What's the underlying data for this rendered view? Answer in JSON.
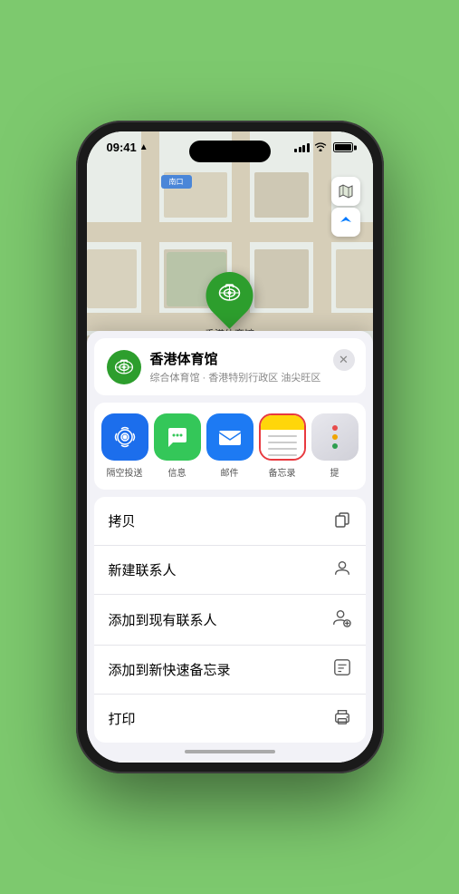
{
  "status_bar": {
    "time": "09:41",
    "location_arrow": "▶"
  },
  "map": {
    "label": "南口",
    "controls": {
      "map_icon": "🗺",
      "location_icon": "➤"
    }
  },
  "pin": {
    "label": "香港体育馆",
    "emoji": "🏟"
  },
  "venue_card": {
    "name": "香港体育馆",
    "subtitle": "综合体育馆 · 香港特别行政区 油尖旺区",
    "icon": "🏟",
    "close": "✕"
  },
  "share_actions": [
    {
      "id": "airdrop",
      "label": "隔空投送",
      "icon": "📡"
    },
    {
      "id": "messages",
      "label": "信息",
      "icon": "💬"
    },
    {
      "id": "mail",
      "label": "邮件",
      "icon": "✉"
    },
    {
      "id": "notes",
      "label": "备忘录",
      "icon": ""
    },
    {
      "id": "more",
      "label": "提",
      "icon": "···"
    }
  ],
  "action_items": [
    {
      "id": "copy",
      "label": "拷贝",
      "icon": "⿻"
    },
    {
      "id": "new-contact",
      "label": "新建联系人",
      "icon": "👤"
    },
    {
      "id": "add-contact",
      "label": "添加到现有联系人",
      "icon": "👤"
    },
    {
      "id": "quick-note",
      "label": "添加到新快速备忘录",
      "icon": "🔳"
    },
    {
      "id": "print",
      "label": "打印",
      "icon": "🖨"
    }
  ]
}
